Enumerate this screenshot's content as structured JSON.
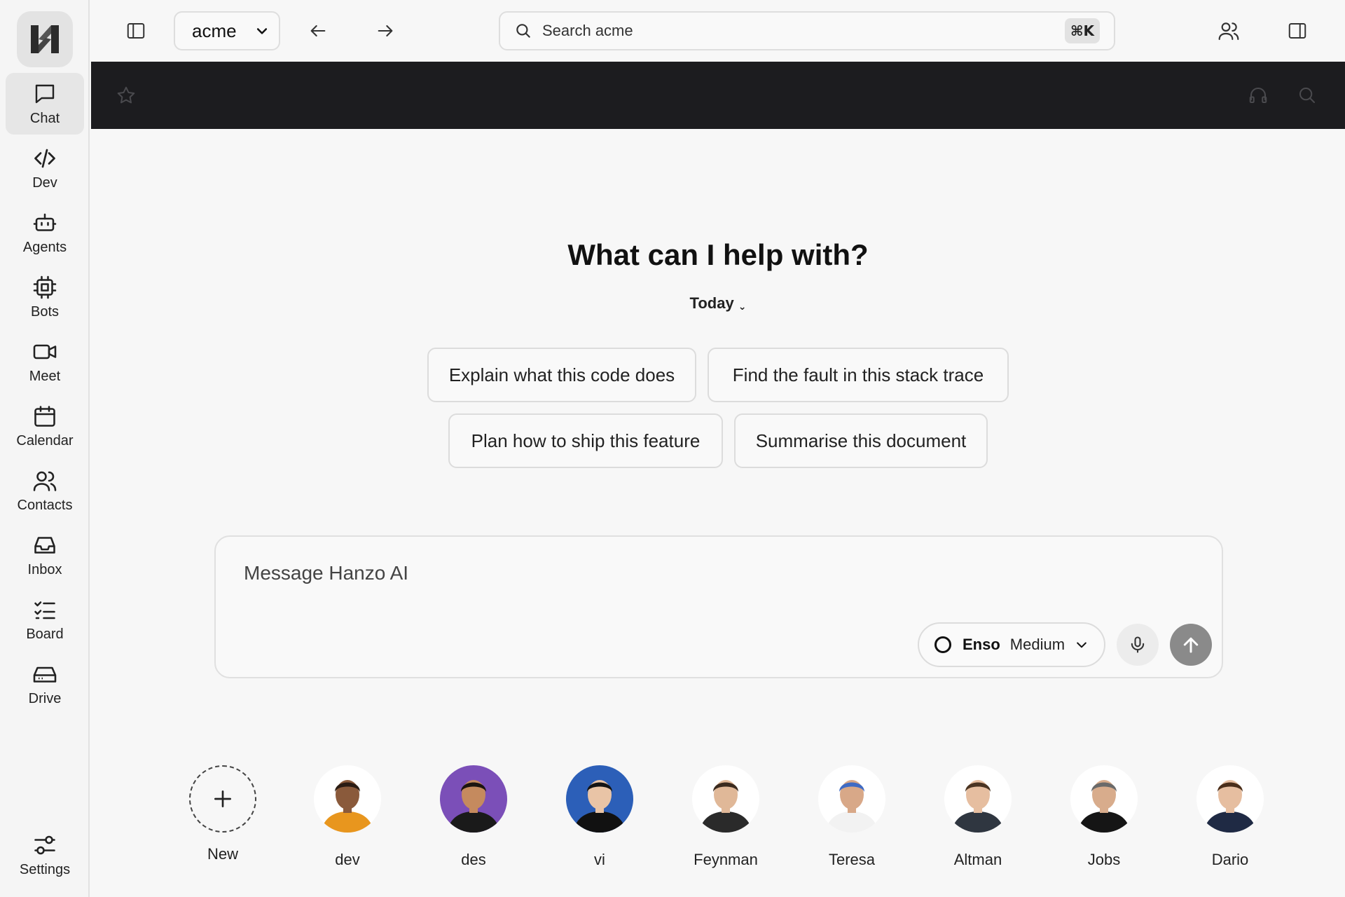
{
  "sidebar": {
    "items": [
      {
        "label": "Chat",
        "icon": "chat-icon"
      },
      {
        "label": "Dev",
        "icon": "code-icon"
      },
      {
        "label": "Agents",
        "icon": "bot-icon"
      },
      {
        "label": "Bots",
        "icon": "cpu-icon"
      },
      {
        "label": "Meet",
        "icon": "video-icon"
      },
      {
        "label": "Calendar",
        "icon": "calendar-icon"
      },
      {
        "label": "Contacts",
        "icon": "users-icon"
      },
      {
        "label": "Inbox",
        "icon": "inbox-icon"
      },
      {
        "label": "Board",
        "icon": "checklist-icon"
      },
      {
        "label": "Drive",
        "icon": "drive-icon"
      }
    ],
    "active": "Chat",
    "settings_label": "Settings"
  },
  "topbar": {
    "org": "acme",
    "search_placeholder": "Search acme",
    "shortcut": "⌘K"
  },
  "main": {
    "heading": "What can I help with?",
    "period": "Today",
    "chevron": "⌄",
    "suggestions": [
      "Explain what this code does",
      "Find the fault in this stack trace",
      "Plan how to ship this feature",
      "Summarise this document"
    ]
  },
  "composer": {
    "placeholder": "Message Hanzo AI",
    "model_name": "Enso",
    "model_level": "Medium"
  },
  "agents": [
    {
      "name": "New"
    },
    {
      "name": "dev",
      "bg": "#ffffff",
      "shirt": "#e8961e",
      "skin": "#8a5a3b",
      "hair": "#2a1c14"
    },
    {
      "name": "des",
      "bg": "#7b4fb8",
      "shirt": "#1a1a1a",
      "skin": "#c58a5e",
      "hair": "#1c1410"
    },
    {
      "name": "vi",
      "bg": "#2c5fb8",
      "shirt": "#111111",
      "skin": "#e9c4a6",
      "hair": "#141414"
    },
    {
      "name": "Feynman",
      "bg": "#ffffff",
      "shirt": "#2a2a2a",
      "skin": "#e0b898",
      "hair": "#3a2a1e"
    },
    {
      "name": "Teresa",
      "bg": "#ffffff",
      "shirt": "#f2f2f2",
      "skin": "#d8a888",
      "hair": "#3f6bc4"
    },
    {
      "name": "Altman",
      "bg": "#ffffff",
      "shirt": "#2f3640",
      "skin": "#e6bea0",
      "hair": "#4a3422"
    },
    {
      "name": "Jobs",
      "bg": "#ffffff",
      "shirt": "#151515",
      "skin": "#d8ac8c",
      "hair": "#6a6a6a"
    },
    {
      "name": "Dario",
      "bg": "#ffffff",
      "shirt": "#1f2a44",
      "skin": "#e6bea0",
      "hair": "#4a2e1a"
    }
  ]
}
